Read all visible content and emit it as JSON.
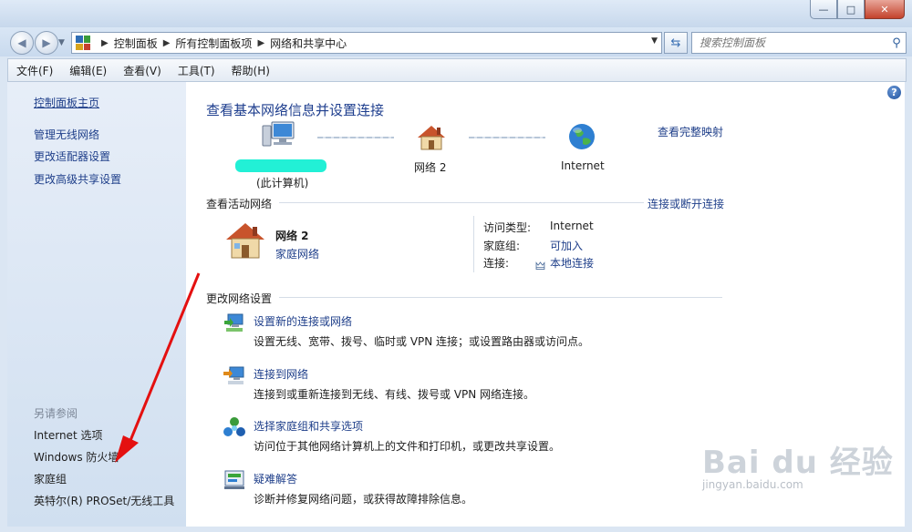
{
  "window": {
    "min": "—",
    "max": "□",
    "close": "✕"
  },
  "address": {
    "breadcrumbs": [
      "控制面板",
      "所有控制面板项",
      "网络和共享中心"
    ],
    "search_placeholder": "搜索控制面板"
  },
  "menu": [
    "文件(F)",
    "编辑(E)",
    "查看(V)",
    "工具(T)",
    "帮助(H)"
  ],
  "sidebar": {
    "home": "控制面板主页",
    "links": [
      "管理无线网络",
      "更改适配器设置",
      "更改高级共享设置"
    ],
    "see_also_header": "另请参阅",
    "see_also": [
      "Internet 选项",
      "Windows 防火墙",
      "家庭组",
      "英特尔(R) PROSet/无线工具"
    ]
  },
  "content": {
    "title": "查看基本网络信息并设置连接",
    "full_map": "查看完整映射",
    "map": {
      "computer": "(此计算机)",
      "network": "网络  2",
      "internet": "Internet"
    },
    "active_networks": {
      "header": "查看活动网络",
      "connect_link": "连接或断开连接",
      "name": "网络  2",
      "type": "家庭网络",
      "access_type_label": "访问类型:",
      "access_type_value": "Internet",
      "homegroup_label": "家庭组:",
      "homegroup_value": "可加入",
      "connection_label": "连接:",
      "connection_value": "本地连接"
    },
    "change_settings": {
      "header": "更改网络设置",
      "tasks": [
        {
          "title": "设置新的连接或网络",
          "desc": "设置无线、宽带、拨号、临时或 VPN 连接；或设置路由器或访问点。"
        },
        {
          "title": "连接到网络",
          "desc": "连接到或重新连接到无线、有线、拨号或 VPN 网络连接。"
        },
        {
          "title": "选择家庭组和共享选项",
          "desc": "访问位于其他网络计算机上的文件和打印机，或更改共享设置。"
        },
        {
          "title": "疑难解答",
          "desc": "诊断并修复网络问题，或获得故障排除信息。"
        }
      ]
    }
  },
  "help": "?",
  "watermark": {
    "big": "Bai du 经验",
    "small": "jingyan.baidu.com"
  },
  "colors": {
    "link": "#1f3f8a",
    "sidebar_bg": "#dce7f4",
    "highlight": "#22f0d6",
    "arrow": "#e41010"
  }
}
